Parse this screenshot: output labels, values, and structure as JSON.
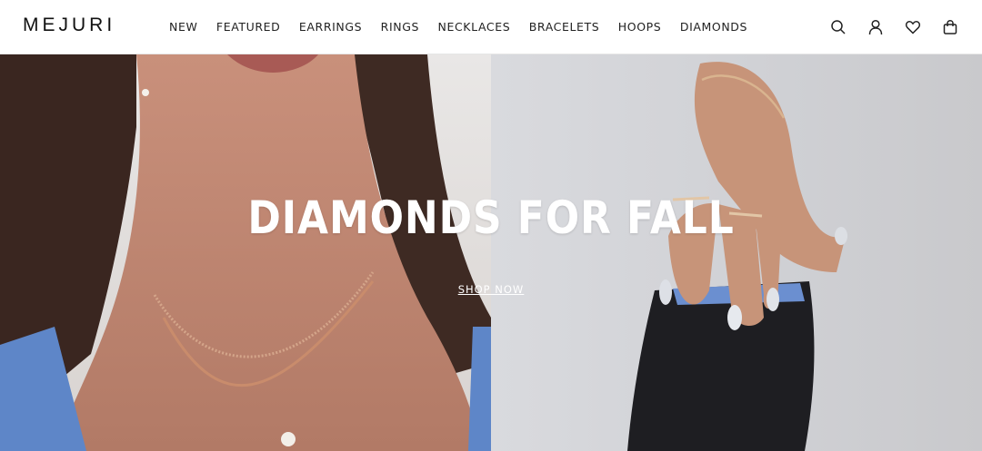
{
  "header": {
    "logo": "MEJURI",
    "nav": [
      "NEW",
      "FEATURED",
      "EARRINGS",
      "RINGS",
      "NECKLACES",
      "BRACELETS",
      "HOOPS",
      "DIAMONDS"
    ],
    "icons": [
      "search-icon",
      "account-icon",
      "wishlist-heart-icon",
      "shopping-bag-icon"
    ]
  },
  "hero": {
    "headline": "DIAMONDS FOR FALL",
    "cta_label": "SHOP NOW"
  },
  "colors": {
    "text": "#111111",
    "hero_text": "#ffffff",
    "header_border": "#e6e6e6"
  }
}
